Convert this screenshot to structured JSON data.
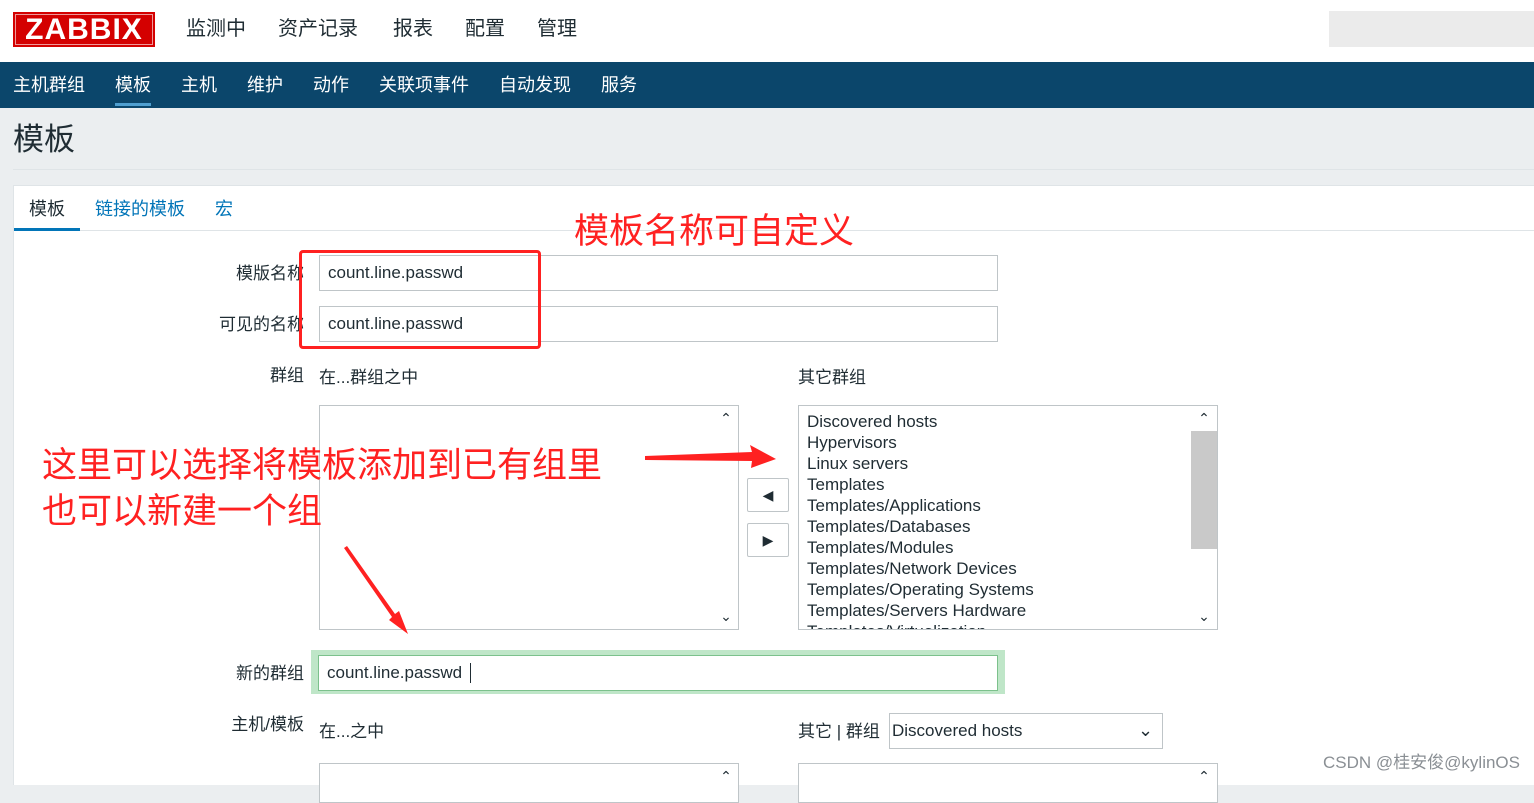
{
  "header": {
    "logo_text": "ZABBIX",
    "nav": [
      "监测中",
      "资产记录",
      "报表",
      "配置",
      "管理"
    ],
    "active_nav": "配置"
  },
  "subnav": {
    "items": [
      "主机群组",
      "模板",
      "主机",
      "维护",
      "动作",
      "关联项事件",
      "自动发现",
      "服务"
    ],
    "active": "模板"
  },
  "page": {
    "title": "模板"
  },
  "tabs": [
    "模板",
    "链接的模板",
    "宏"
  ],
  "form": {
    "template_name_label": "模版名称",
    "template_name_value": "count.line.passwd",
    "visible_name_label": "可见的名称",
    "visible_name_value": "count.line.passwd",
    "groups_label": "群组",
    "in_groups_header": "在...群组之中",
    "other_groups_header": "其它群组",
    "other_groups": [
      "Discovered hosts",
      "Hypervisors",
      "Linux servers",
      "Templates",
      "Templates/Applications",
      "Templates/Databases",
      "Templates/Modules",
      "Templates/Network Devices",
      "Templates/Operating Systems",
      "Templates/Servers Hardware",
      "Templates/Virtualization"
    ],
    "new_group_label": "新的群组",
    "new_group_value": "count.line.passwd",
    "hosts_label": "主机/模板",
    "in_header": "在...之中",
    "other_group_prefix": "其它 | 群组",
    "other_group_select": "Discovered hosts"
  },
  "annotations": {
    "title_note": "模板名称可自定义",
    "group_note_line1": "这里可以选择将模板添加到已有组里",
    "group_note_line2": "也可以新建一个组"
  },
  "watermark": "CSDN @桂安俊@kylinOS",
  "colors": {
    "brand_red": "#d40000",
    "subnav_bg": "#0b466b",
    "link_blue": "#0275b8",
    "annotation_red": "#ff2121",
    "focus_green": "#bfe6c8"
  }
}
